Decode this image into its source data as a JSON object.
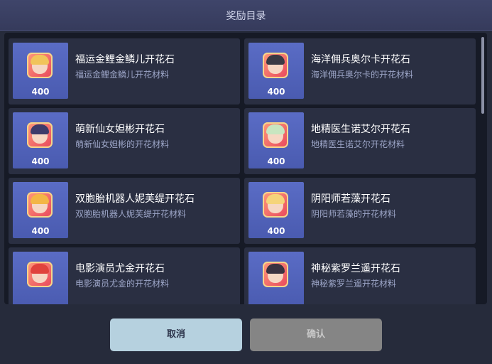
{
  "dialog": {
    "title": "奖励目录",
    "cancel_label": "取消",
    "confirm_label": "确认"
  },
  "rewards": [
    {
      "name": "福运金鲤金鳞儿开花石",
      "desc": "福运金鲤金鳞儿开花材料",
      "qty": "400",
      "hair": "#f1c45a"
    },
    {
      "name": "海洋佣兵奥尔卡开花石",
      "desc": "海洋佣兵奥尔卡的开花材料",
      "qty": "400",
      "hair": "#3a3a44"
    },
    {
      "name": "萌新仙女妲彬开花石",
      "desc": "萌新仙女妲彬的开花材料",
      "qty": "400",
      "hair": "#3d3b6a"
    },
    {
      "name": "地精医生诺艾尔开花石",
      "desc": "地精医生诺艾尔开花材料",
      "qty": "400",
      "hair": "#c8e6c0"
    },
    {
      "name": "双胞胎机器人妮芙缇开花石",
      "desc": "双胞胎机器人妮芙缇开花材料",
      "qty": "400",
      "hair": "#f3b646"
    },
    {
      "name": "阴阳师若藻开花石",
      "desc": "阴阳师若藻的开花材料",
      "qty": "400",
      "hair": "#f5d47a"
    },
    {
      "name": "电影演员尤金开花石",
      "desc": "电影演员尤金的开花材料",
      "qty": "",
      "hair": "#e0433c"
    },
    {
      "name": "神秘紫罗兰遥开花石",
      "desc": "神秘紫罗兰遥开花材料",
      "qty": "",
      "hair": "#3b3340"
    }
  ]
}
